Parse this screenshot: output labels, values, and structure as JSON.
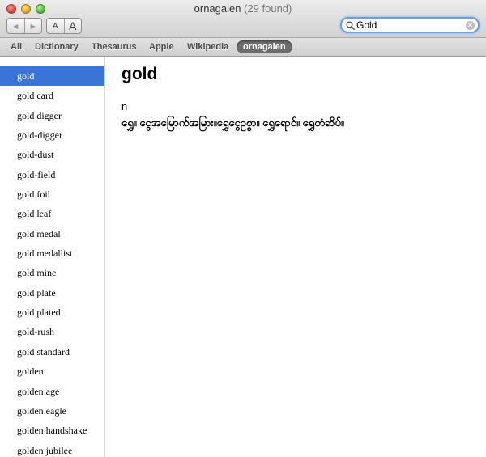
{
  "window": {
    "title": "ornagaien",
    "found_count": "(29 found)"
  },
  "toolbar": {
    "back_glyph": "◀",
    "forward_glyph": "▶",
    "font_smaller_label": "A",
    "font_larger_label": "A",
    "search_value": "Gold",
    "search_clear_glyph": "✕"
  },
  "scopes": [
    {
      "label": "All"
    },
    {
      "label": "Dictionary"
    },
    {
      "label": "Thesaurus"
    },
    {
      "label": "Apple"
    },
    {
      "label": "Wikipedia"
    },
    {
      "label": "ornagaien",
      "active": true
    }
  ],
  "sidebar": {
    "items": [
      "gold",
      "gold card",
      "gold digger",
      "gold-digger",
      "gold-dust",
      "gold-field",
      "gold foil",
      "gold leaf",
      "gold medal",
      "gold medallist",
      "gold mine",
      "gold plate",
      "gold plated",
      "gold-rush",
      "gold standard",
      "golden",
      "golden age",
      "golden eagle",
      "golden handshake",
      "golden jubilee"
    ],
    "selected_index": 0
  },
  "entry": {
    "headword": "gold",
    "part_of_speech": "n",
    "definition": "ရွှေ။ ငွေအမြောက်အမြား။ရွှေငွေဥစ္စာ။ ရွှေရောင်။ ရွှေတံဆိပ်။"
  },
  "colors": {
    "selection": "#3875d7",
    "search_focus": "#6a9fe0",
    "active_scope": "#6d6d6d"
  }
}
